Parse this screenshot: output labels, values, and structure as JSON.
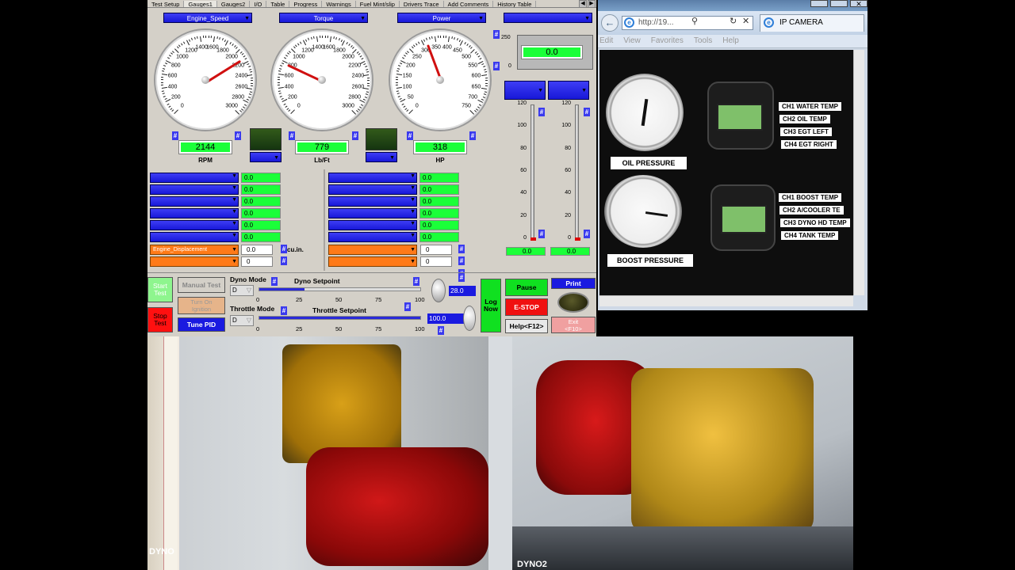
{
  "tabs": [
    "Test Setup",
    "Gauges1",
    "Gauges2",
    "I/O",
    "Table",
    "Progress",
    "Warnings",
    "Fuel Mint/slip",
    "Drivers Trace",
    "Add Comments",
    "History Table"
  ],
  "gauges": [
    {
      "selector": "Engine_Speed",
      "labels": [
        "0",
        "200",
        "400",
        "600",
        "800",
        "1000",
        "1200",
        "1400",
        "1600",
        "1800",
        "2000",
        "2200",
        "2400",
        "2600",
        "2800",
        "3000"
      ],
      "value": "2144",
      "unit": "RPM"
    },
    {
      "selector": "Torque",
      "labels": [
        "0",
        "200",
        "400",
        "600",
        "800",
        "1000",
        "1200",
        "1400",
        "1600",
        "1800",
        "2000",
        "2200",
        "2400",
        "2600",
        "2800",
        "3000"
      ],
      "value": "779",
      "unit": "Lb/Ft"
    },
    {
      "selector": "Power",
      "labels": [
        "0",
        "50",
        "100",
        "150",
        "200",
        "250",
        "300",
        "350",
        "400",
        "450",
        "500",
        "550",
        "600",
        "650",
        "700",
        "750"
      ],
      "value": "318",
      "unit": "HP"
    }
  ],
  "small_meter": {
    "scale": [
      "250",
      "0"
    ],
    "value": "0.0"
  },
  "vsliders": {
    "scale": [
      "120",
      "100",
      "80",
      "60",
      "40",
      "20",
      "0"
    ],
    "values": [
      "0.0",
      "0.0"
    ]
  },
  "channel_rows_left": [
    "0.0",
    "0.0",
    "0.0",
    "0.0",
    "0.0",
    "0.0"
  ],
  "channel_rows_right": [
    "0.0",
    "0.0",
    "0.0",
    "0.0",
    "0.0",
    "0.0"
  ],
  "engine_displacement": {
    "label": "Engine_Displacement",
    "value": "0.0",
    "unit": "cu.in.",
    "second": "0"
  },
  "right_inputs": [
    "0",
    "0"
  ],
  "controls": {
    "start_test": "Start\nTest",
    "stop_test": "Stop\nTest",
    "manual_test": "Manual Test",
    "turn_on_ignition": "Turn On\nIgnition",
    "tune_pid": "Tune PID",
    "dyno_mode": "Dyno Mode",
    "dyno_mode_value": "D",
    "dyno_setpoint": "Dyno Setpoint",
    "dyno_value": "28.0",
    "throttle_mode": "Throttle Mode",
    "throttle_mode_value": "D",
    "throttle_setpoint": "Throttle Setpoint",
    "throttle_value": "100.0",
    "scale": [
      "0",
      "25",
      "50",
      "75",
      "100"
    ],
    "log_now": "Log\nNow",
    "pause": "Pause",
    "estop": "E-STOP",
    "help": "Help<F12>",
    "print": "Print",
    "exit": "Exit\n<F10>"
  },
  "dyno_setpoint_level": 0.28,
  "throttle_setpoint_level": 1.0,
  "ie": {
    "menu": [
      "Edit",
      "View",
      "Favorites",
      "Tools",
      "Help"
    ],
    "address": "http://19...",
    "tab_title": "IP CAMERA",
    "panel_labels": [
      "OIL PRESSURE",
      "BOOST PRESSURE"
    ],
    "channels_top": [
      "CH1  WATER TEMP",
      "CH2  OIL TEMP",
      "CH3  EGT LEFT",
      "CH4  EGT RIGHT"
    ],
    "channels_bottom": [
      "CH1  BOOST TEMP",
      "CH2  A/COOLER TE",
      "CH3  DYNO HD TEMP",
      "CH4  TANK TEMP"
    ]
  },
  "cams": [
    "DYNO",
    "DYNO2"
  ]
}
